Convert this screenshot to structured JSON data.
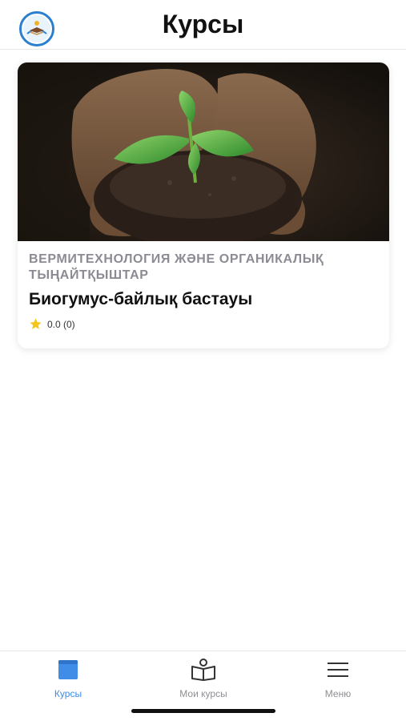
{
  "header": {
    "title": "Курсы"
  },
  "course": {
    "category": "ВЕРМИТЕХНОЛОГИЯ ЖӘНЕ ОРГАНИКАЛЫҚ ТЫҢАЙТҚЫШТАР",
    "title": "Биогумус-байлық бастауы",
    "rating_text": "0.0 (0)",
    "rating_value": 0.0,
    "rating_count": 0,
    "image_icon": "seedling-in-soil-image"
  },
  "tabs": [
    {
      "label": "Курсы",
      "icon": "book-icon",
      "active": true
    },
    {
      "label": "Мои курсы",
      "icon": "open-book-icon",
      "active": false
    },
    {
      "label": "Меню",
      "icon": "menu-icon",
      "active": false
    }
  ],
  "colors": {
    "accent": "#3f8de6",
    "inactive": "#8e8e93",
    "category_text": "#8b8b93",
    "star": "#f5c518"
  }
}
